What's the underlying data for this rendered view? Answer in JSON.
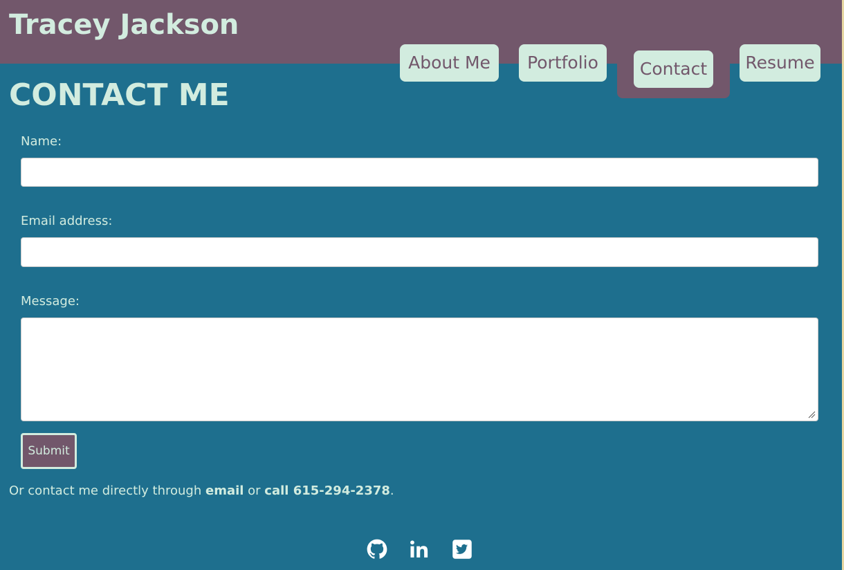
{
  "colors": {
    "header_bg": "#72576b",
    "page_bg": "#1e6f8e",
    "accent_light": "#d2ecdf",
    "right_strip": "#e7d7a2"
  },
  "header": {
    "title": "Tracey Jackson"
  },
  "nav": {
    "items": [
      {
        "label": "About Me",
        "active": false
      },
      {
        "label": "Portfolio",
        "active": false
      },
      {
        "label": "Contact",
        "active": true
      },
      {
        "label": "Resume",
        "active": false
      }
    ]
  },
  "page": {
    "heading": "CONTACT ME"
  },
  "form": {
    "name_label": "Name:",
    "name_value": "",
    "email_label": "Email address:",
    "email_value": "",
    "message_label": "Message:",
    "message_value": "",
    "submit_label": "Submit"
  },
  "contact_info": {
    "prefix": "Or contact me directly through ",
    "email_link": "email",
    "middle": " or ",
    "call_link": "call 615-294-2378",
    "suffix": "."
  },
  "footer": {
    "icons": [
      "github-icon",
      "linkedin-icon",
      "twitter-icon"
    ]
  }
}
